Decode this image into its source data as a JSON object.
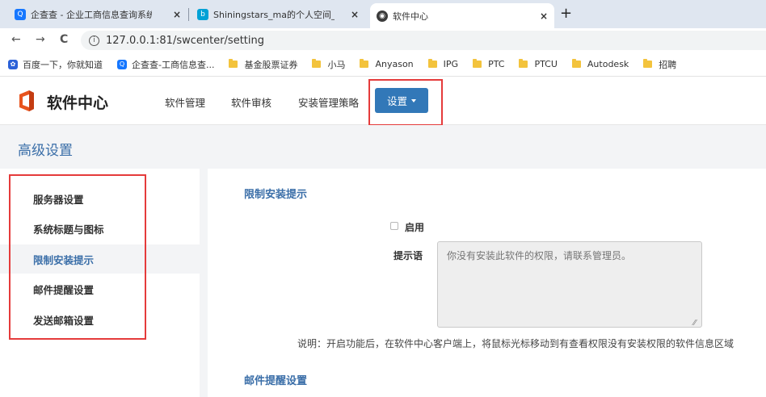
{
  "browser": {
    "tabs": [
      {
        "title": "企查查 - 企业工商信息查询系统_",
        "icon": "qichacha-icon",
        "active": false
      },
      {
        "title": "Shiningstars_ma的个人空间_哔",
        "icon": "bilibili-icon",
        "active": false
      },
      {
        "title": "软件中心",
        "icon": "globe-icon",
        "active": true
      }
    ],
    "close_glyph": "×",
    "new_tab_glyph": "+",
    "url": "127.0.0.1:81/swcenter/setting",
    "nav": {
      "back": "←",
      "forward": "→",
      "reload": "C",
      "info": "i"
    }
  },
  "bookmarks": [
    {
      "label": "百度一下，你就知道",
      "type": "baidu-icon"
    },
    {
      "label": "企查查-工商信息查...",
      "type": "qichacha-icon"
    },
    {
      "label": "基金股票证券",
      "type": "folder-icon"
    },
    {
      "label": "小马",
      "type": "folder-icon"
    },
    {
      "label": "Anyason",
      "type": "folder-icon"
    },
    {
      "label": "IPG",
      "type": "folder-icon"
    },
    {
      "label": "PTC",
      "type": "folder-icon"
    },
    {
      "label": "PTCU",
      "type": "folder-icon"
    },
    {
      "label": "Autodesk",
      "type": "folder-icon"
    },
    {
      "label": "招聘",
      "type": "folder-icon"
    }
  ],
  "header": {
    "app_title": "软件中心",
    "nav": [
      "软件管理",
      "软件审核",
      "安装管理策略"
    ],
    "settings_label": "设置"
  },
  "page": {
    "title": "高级设置",
    "sidebar": [
      {
        "label": "服务器设置",
        "active": false
      },
      {
        "label": "系统标题与图标",
        "active": false
      },
      {
        "label": "限制安装提示",
        "active": true
      },
      {
        "label": "邮件提醒设置",
        "active": false
      },
      {
        "label": "发送邮箱设置",
        "active": false
      }
    ],
    "section_restrict": {
      "title": "限制安装提示",
      "enable_label": "启用",
      "enabled": false,
      "prompt_label": "提示语",
      "prompt_placeholder": "你没有安装此软件的权限，请联系管理员。",
      "description": "说明：开启功能后，在软件中心客户端上，将鼠标光标移动到有查看权限没有安装权限的软件信息区域"
    },
    "section_mail": {
      "title": "邮件提醒设置"
    }
  },
  "colors": {
    "accent": "#3278b8",
    "link_blue": "#3a6ea8",
    "highlight_red": "#e53b3b",
    "logo_orange": "#e8541e"
  }
}
